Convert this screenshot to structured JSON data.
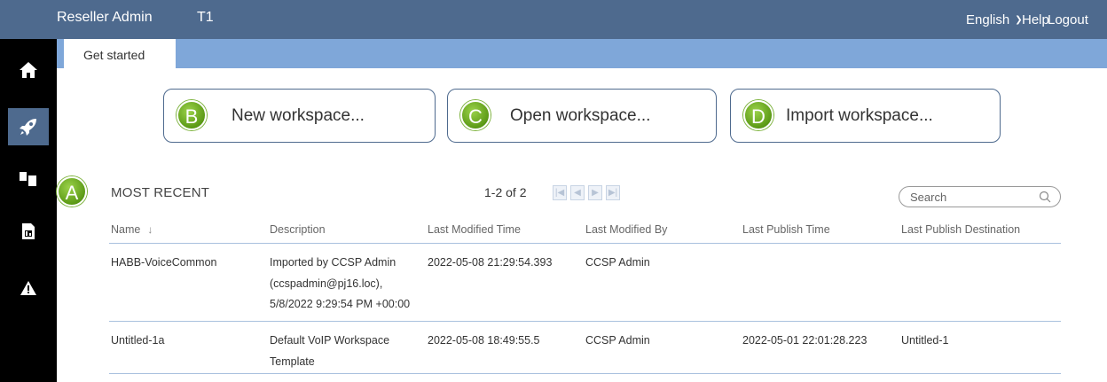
{
  "header": {
    "app_title": "Reseller Admin",
    "tenant": "T1",
    "language": "English",
    "help": "Help",
    "logout": "Logout",
    "bg_color": "#4e6a8e"
  },
  "leftnav": {
    "items": [
      {
        "icon": "home-icon"
      },
      {
        "icon": "rocket-icon",
        "active": true
      },
      {
        "icon": "documents-icon"
      },
      {
        "icon": "report-icon"
      },
      {
        "icon": "warning-icon"
      }
    ]
  },
  "tabs": [
    {
      "label": "Get started",
      "active": true
    }
  ],
  "actions": [
    {
      "badge": "B",
      "label": "New workspace..."
    },
    {
      "badge": "C",
      "label": "Open workspace..."
    },
    {
      "badge": "D",
      "label": "Import workspace..."
    }
  ],
  "recent": {
    "marker": "A",
    "title": "MOST RECENT",
    "pager": "1-2 of 2",
    "search_placeholder": "Search",
    "columns": [
      "Name",
      "Description",
      "Last Modified Time",
      "Last Modified By",
      "Last Publish Time",
      "Last Publish Destination"
    ],
    "sort_indicator": "↓",
    "rows": [
      {
        "name": "HABB-VoiceCommon",
        "description": "Imported by CCSP Admin (ccspadmin@pj16.loc), 5/8/2022 9:29:54 PM +00:00",
        "description_lines": [
          "Imported by CCSP Admin",
          "(ccspadmin@pj16.loc),",
          "5/8/2022 9:29:54 PM +00:00"
        ],
        "last_modified_time": "2022-05-08 21:29:54.393",
        "last_modified_by": "CCSP Admin",
        "last_publish_time": "",
        "last_publish_destination": ""
      },
      {
        "name": "Untitled-1a",
        "description": "Default VoIP Workspace Template",
        "description_lines": [
          "Default VoIP Workspace",
          "Template"
        ],
        "last_modified_time": "2022-05-08 18:49:55.5",
        "last_modified_by": "CCSP Admin",
        "last_publish_time": "2022-05-01 22:01:28.223",
        "last_publish_destination": "Untitled-1"
      }
    ]
  },
  "colors": {
    "accent": "#4e6a8e",
    "tabstrip": "#7fa7d9",
    "badge_green": "#6aa820"
  }
}
